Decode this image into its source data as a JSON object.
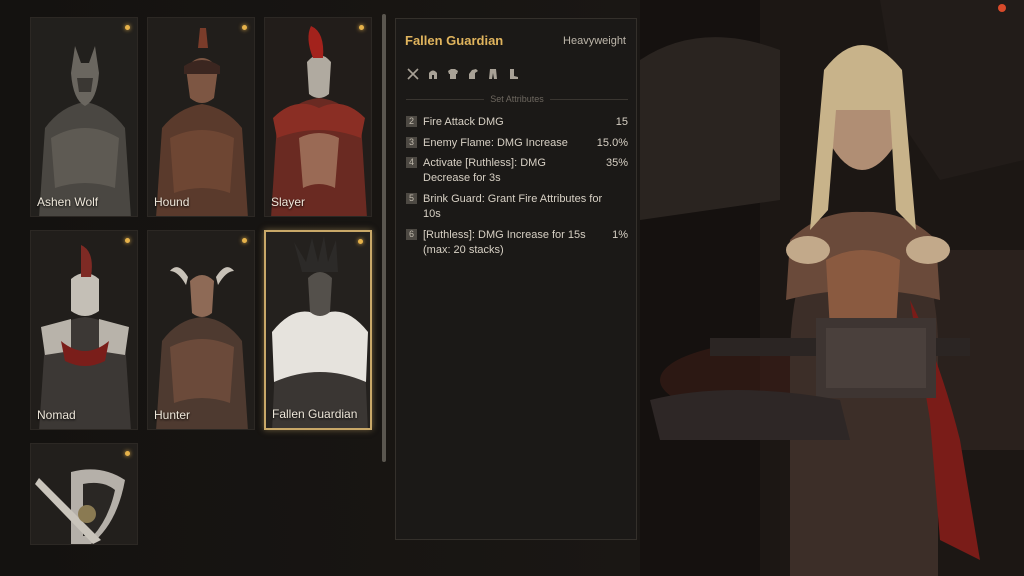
{
  "cards": [
    {
      "name": "Ashen Wolf"
    },
    {
      "name": "Hound"
    },
    {
      "name": "Slayer"
    },
    {
      "name": "Nomad"
    },
    {
      "name": "Hunter"
    },
    {
      "name": "Fallen Guardian"
    },
    {
      "name": ""
    }
  ],
  "selected_set": {
    "name": "Fallen Guardian",
    "weight": "Heavyweight",
    "gear_icons": [
      "sword-icon",
      "helmet-icon",
      "chest-icon",
      "gloves-icon",
      "pants-icon",
      "boots-icon"
    ],
    "section_title": "Set Attributes",
    "attributes": [
      {
        "pieces": "2",
        "text": "Fire Attack DMG",
        "value": "15"
      },
      {
        "pieces": "3",
        "text": "Enemy Flame: DMG Increase",
        "value": "15.0%"
      },
      {
        "pieces": "4",
        "text": "Activate [Ruthless]: DMG Decrease for 3s",
        "value": "35%"
      },
      {
        "pieces": "5",
        "text": "Brink Guard: Grant Fire Attributes for 10s",
        "value": ""
      },
      {
        "pieces": "6",
        "text": "[Ruthless]: DMG Increase for 15s (max: 20 stacks)",
        "value": "1%"
      }
    ]
  },
  "colors": {
    "accent": "#e0b45d",
    "selected_border": "#c9a868",
    "indicator": "#e6b24a"
  }
}
